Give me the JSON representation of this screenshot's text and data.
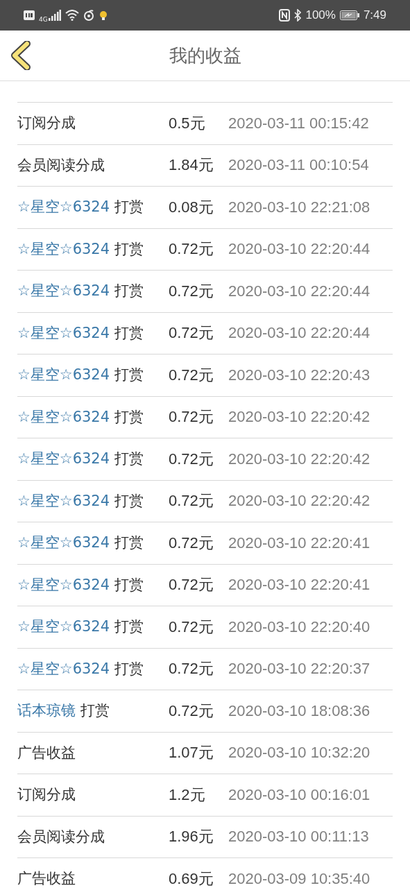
{
  "status_bar": {
    "network": "4G",
    "battery": "100%",
    "time": "7:49"
  },
  "header": {
    "title": "我的收益"
  },
  "rows": [
    {
      "kind": "plain",
      "name": "订阅分成",
      "amount": "0.5元",
      "time": "2020-03-11 00:15:42"
    },
    {
      "kind": "plain",
      "name": "会员阅读分成",
      "amount": "1.84元",
      "time": "2020-03-11 00:10:54"
    },
    {
      "kind": "reward",
      "user": "☆星空☆6324",
      "action": "打赏",
      "amount": "0.08元",
      "time": "2020-03-10 22:21:08"
    },
    {
      "kind": "reward",
      "user": "☆星空☆6324",
      "action": "打赏",
      "amount": "0.72元",
      "time": "2020-03-10 22:20:44"
    },
    {
      "kind": "reward",
      "user": "☆星空☆6324",
      "action": "打赏",
      "amount": "0.72元",
      "time": "2020-03-10 22:20:44"
    },
    {
      "kind": "reward",
      "user": "☆星空☆6324",
      "action": "打赏",
      "amount": "0.72元",
      "time": "2020-03-10 22:20:44"
    },
    {
      "kind": "reward",
      "user": "☆星空☆6324",
      "action": "打赏",
      "amount": "0.72元",
      "time": "2020-03-10 22:20:43"
    },
    {
      "kind": "reward",
      "user": "☆星空☆6324",
      "action": "打赏",
      "amount": "0.72元",
      "time": "2020-03-10 22:20:42"
    },
    {
      "kind": "reward",
      "user": "☆星空☆6324",
      "action": "打赏",
      "amount": "0.72元",
      "time": "2020-03-10 22:20:42"
    },
    {
      "kind": "reward",
      "user": "☆星空☆6324",
      "action": "打赏",
      "amount": "0.72元",
      "time": "2020-03-10 22:20:42"
    },
    {
      "kind": "reward",
      "user": "☆星空☆6324",
      "action": "打赏",
      "amount": "0.72元",
      "time": "2020-03-10 22:20:41"
    },
    {
      "kind": "reward",
      "user": "☆星空☆6324",
      "action": "打赏",
      "amount": "0.72元",
      "time": "2020-03-10 22:20:41"
    },
    {
      "kind": "reward",
      "user": "☆星空☆6324",
      "action": "打赏",
      "amount": "0.72元",
      "time": "2020-03-10 22:20:40"
    },
    {
      "kind": "reward",
      "user": "☆星空☆6324",
      "action": "打赏",
      "amount": "0.72元",
      "time": "2020-03-10 22:20:37"
    },
    {
      "kind": "reward",
      "user": "话本琼镜",
      "action": "打赏",
      "amount": "0.72元",
      "time": "2020-03-10 18:08:36"
    },
    {
      "kind": "plain",
      "name": "广告收益",
      "amount": "1.07元",
      "time": "2020-03-10 10:32:20"
    },
    {
      "kind": "plain",
      "name": "订阅分成",
      "amount": "1.2元",
      "time": "2020-03-10 00:16:01"
    },
    {
      "kind": "plain",
      "name": "会员阅读分成",
      "amount": "1.96元",
      "time": "2020-03-10 00:11:13"
    },
    {
      "kind": "plain",
      "name": "广告收益",
      "amount": "0.69元",
      "time": "2020-03-09 10:35:40"
    }
  ]
}
